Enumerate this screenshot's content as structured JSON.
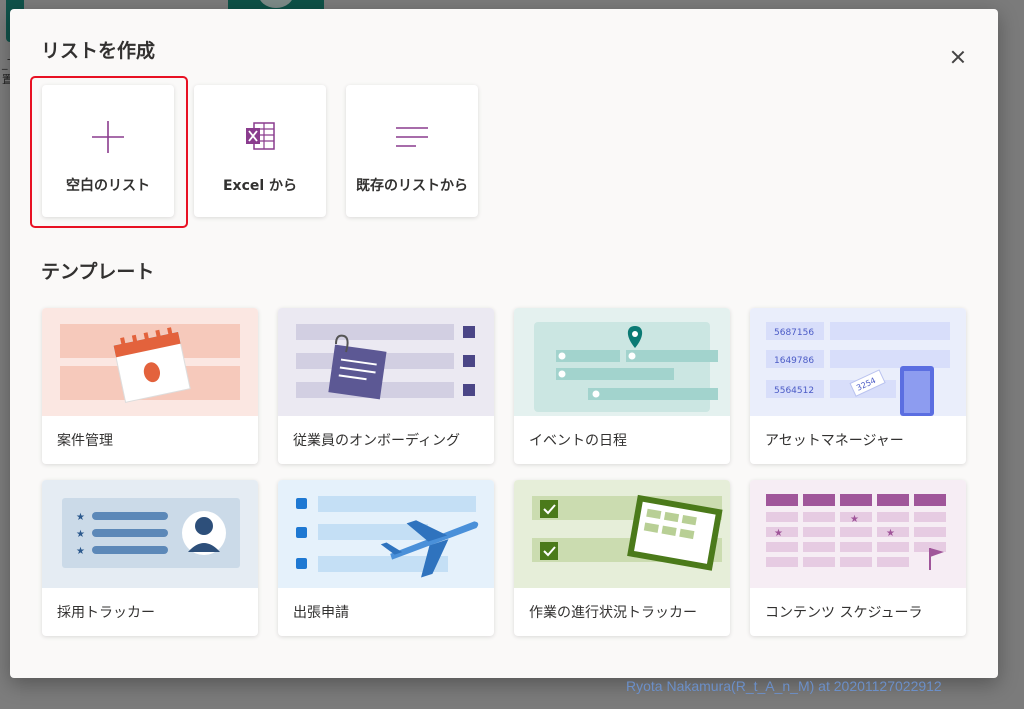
{
  "background": {
    "left_text_1": "_T",
    "left_text_2": "置"
  },
  "dialog": {
    "title": "リストを作成",
    "close_label": "×",
    "create_options": [
      {
        "label": "空白のリスト",
        "icon": "plus-icon"
      },
      {
        "label": "Excel から",
        "icon": "excel-icon"
      },
      {
        "label": "既存のリストから",
        "icon": "list-lines-icon"
      }
    ],
    "templates_heading": "テンプレート",
    "templates": [
      {
        "label": "案件管理"
      },
      {
        "label": "従業員のオンボーディング"
      },
      {
        "label": "イベントの日程"
      },
      {
        "label": "アセットマネージャー",
        "art_numbers": [
          "5687156",
          "1649786",
          "5564512"
        ],
        "tag_number": "3254"
      },
      {
        "label": "採用トラッカー"
      },
      {
        "label": "出張申請"
      },
      {
        "label": "作業の進行状況トラッカー"
      },
      {
        "label": "コンテンツ スケジューラ"
      }
    ]
  },
  "watermark": "Ryota Nakamura(R_t_A_n_M) at 20201127022912",
  "colors": {
    "accent": "#8a3c8e",
    "highlight": "#e81123",
    "dialog_bg": "#faf9f8"
  }
}
